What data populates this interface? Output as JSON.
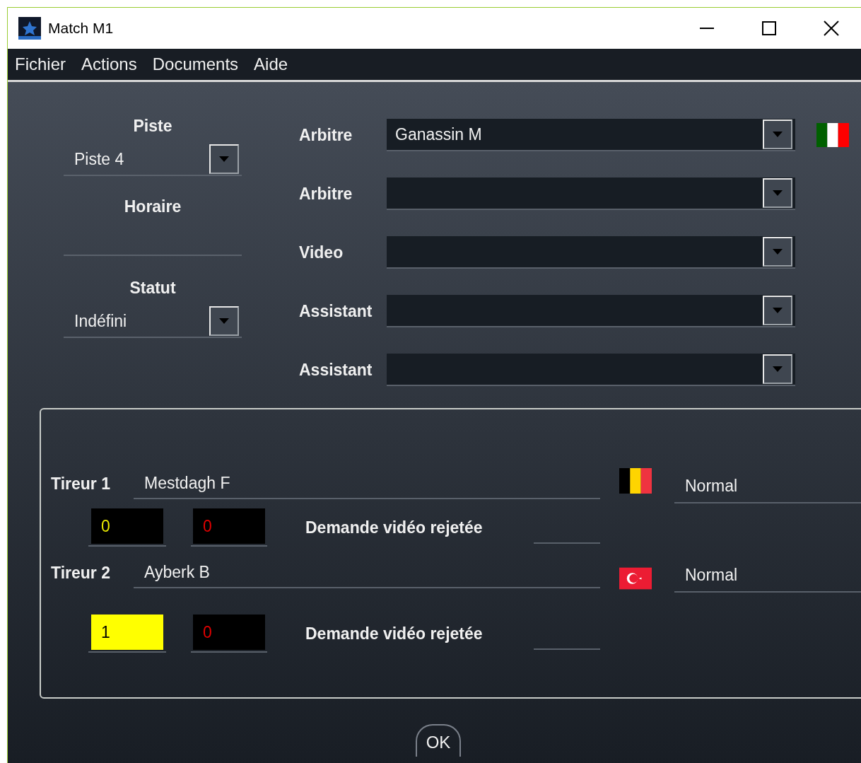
{
  "window": {
    "title": "Match M1"
  },
  "menu": [
    "Fichier",
    "Actions",
    "Documents",
    "Aide"
  ],
  "left": {
    "piste_label": "Piste",
    "piste": "Piste 4",
    "horaire_label": "Horaire",
    "statut_label": "Statut",
    "statut": "Indéfini"
  },
  "officials": [
    {
      "label": "Arbitre",
      "value": "Ganassin M",
      "kind": "italy"
    },
    {
      "label": "Arbitre",
      "kind": "plain"
    },
    {
      "label": "Video",
      "kind": "plain"
    },
    {
      "label": "Assistant",
      "kind": "plain"
    },
    {
      "label": "Assistant",
      "kind": "plain"
    }
  ],
  "fencers": [
    {
      "label": "Tireur 1",
      "name": "Mestdagh F",
      "kind": "belgium",
      "status": "Normal",
      "yellow": {
        "value": "0",
        "highlighted": false
      },
      "red": {
        "value": "0"
      },
      "video_label": "Demande vidéo rejetée"
    },
    {
      "label": "Tireur 2",
      "name": "Ayberk B",
      "kind": "turkey",
      "status": "Normal",
      "yellow": {
        "value": "1",
        "highlighted": true
      },
      "red": {
        "value": "0"
      },
      "video_label": "Demande vidéo rejetée"
    }
  ],
  "ok_button": "OK"
}
